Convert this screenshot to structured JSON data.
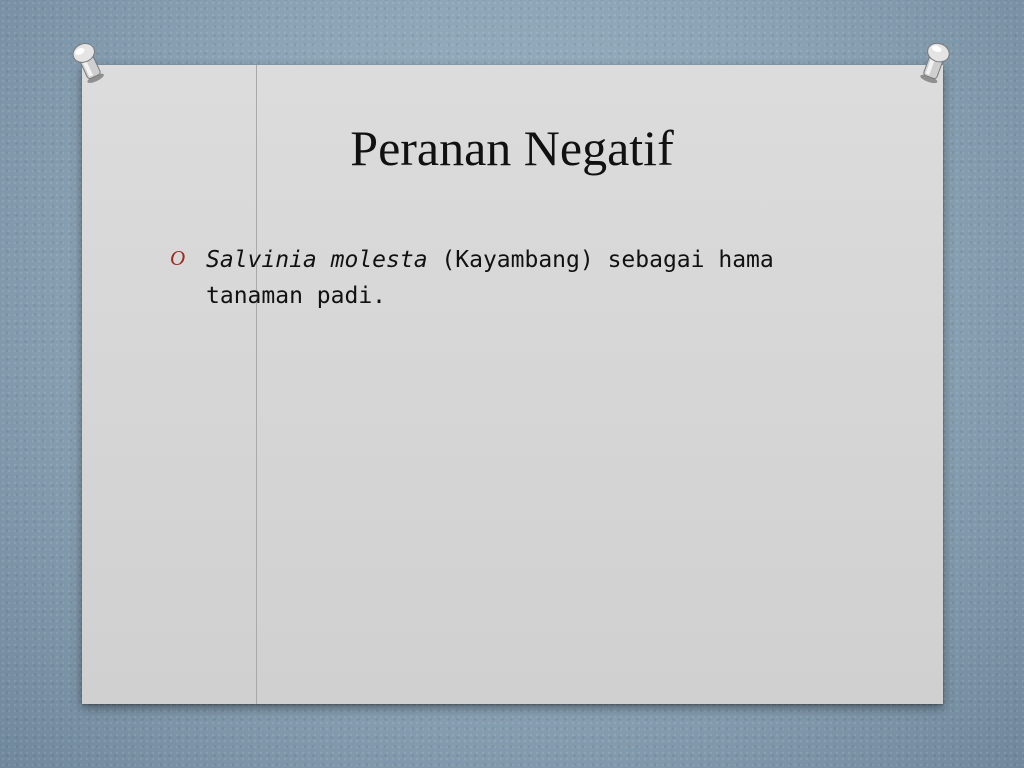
{
  "slide": {
    "title": "Peranan Negatif",
    "bullet": {
      "marker": "O",
      "italic_part": "Salvinia molesta",
      "rest_part": " (Kayambang) sebagai hama tanaman padi."
    }
  },
  "colors": {
    "background": "#8fa7b8",
    "paper": "#d4d4d4",
    "bullet_marker": "#9c2a1e",
    "text": "#111111"
  },
  "icons": {
    "left_pin": "push-pin-icon",
    "right_pin": "push-pin-icon"
  }
}
